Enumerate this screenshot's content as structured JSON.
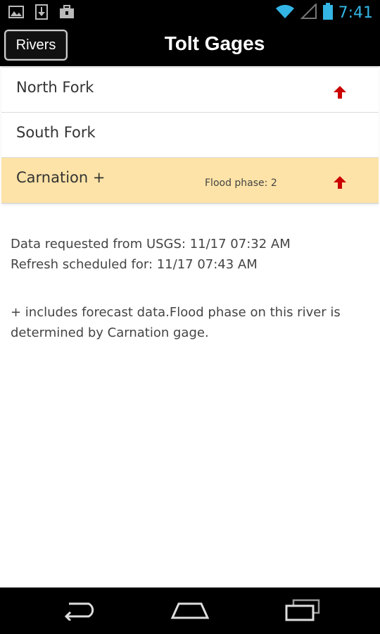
{
  "status_bar": {
    "time": "7:41",
    "left_icons": [
      "image-icon",
      "download-icon",
      "briefcase-icon"
    ],
    "right_icons": [
      "wifi-icon",
      "signal-icon",
      "battery-icon"
    ],
    "accent_color": "#33b5e5"
  },
  "action_bar": {
    "rivers_button_label": "Rivers",
    "title": "Tolt Gages"
  },
  "gages": [
    {
      "name": "North Fork",
      "phase_text": "",
      "trend": "up",
      "trend_icon": "arrow-up-icon",
      "highlighted": false
    },
    {
      "name": "South Fork",
      "phase_text": "",
      "trend": "",
      "trend_icon": "",
      "highlighted": false
    },
    {
      "name": "Carnation +",
      "phase_text": "Flood phase: 2",
      "trend": "up",
      "trend_icon": "arrow-up-icon",
      "highlighted": true
    }
  ],
  "info": {
    "requested": "Data requested from USGS: 11/17 07:32 AM",
    "refresh": "Refresh scheduled for: 11/17 07:43 AM",
    "note": "+ includes forecast data.Flood phase on this river is determined by Carnation gage."
  },
  "colors": {
    "highlight_row": "#fde3a7",
    "trend_up": "#cc0000"
  },
  "nav_bar": {
    "buttons": [
      "back-icon",
      "home-icon",
      "recent-apps-icon"
    ]
  }
}
